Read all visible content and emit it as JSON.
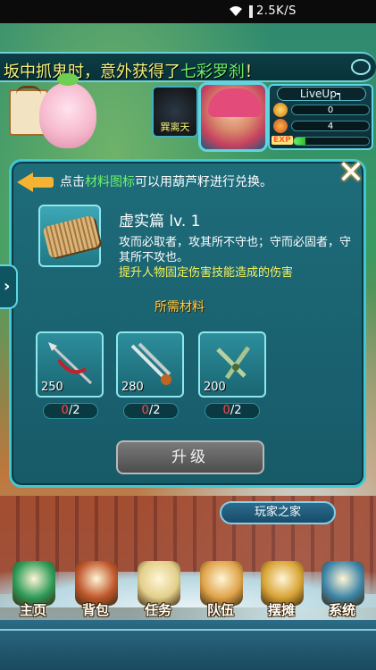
{
  "status_bar": {
    "network_speed": "2.5K/S"
  },
  "marquee": {
    "text_before": "坂中抓鬼时，意外获得了",
    "highlight": "七彩罗刹",
    "text_after": "！"
  },
  "player": {
    "pet_label": "巽离天",
    "name": "LiveUp┑",
    "gold": "0",
    "gems": "4",
    "exp_label": "EXP",
    "exp_progress": 0.15
  },
  "dialog": {
    "hint_before": "点击",
    "hint_highlight": "材料图标",
    "hint_after": "可以用葫芦籽进行兑换。",
    "item": {
      "title": "虚实篇 lv. 1",
      "description": "攻而必取者，攻其所不守也；守而必固者，守其所不攻也。",
      "effect": "提升人物固定伤害技能造成的伤害"
    },
    "required_label": "所需材料",
    "materials": [
      {
        "qty": "250",
        "have": "0",
        "need": "/2",
        "icon": "red-spear-icon"
      },
      {
        "qty": "280",
        "have": "0",
        "need": "/2",
        "icon": "twin-swords-icon"
      },
      {
        "qty": "200",
        "have": "0",
        "need": "/2",
        "icon": "twin-daggers-icon"
      }
    ],
    "upgrade_label": "升级"
  },
  "home_tag": "玩家之家",
  "nav": [
    {
      "label": "主页",
      "icon": "house-icon",
      "color": "#2e9b58"
    },
    {
      "label": "背包",
      "icon": "chest-icon",
      "color": "#c0572c"
    },
    {
      "label": "任务",
      "icon": "scroll-icon",
      "color": "#e3cf8b"
    },
    {
      "label": "队伍",
      "icon": "team-icon",
      "color": "#e0a34a"
    },
    {
      "label": "摆摊",
      "icon": "coin-stall-icon",
      "color": "#d8a335"
    },
    {
      "label": "系统",
      "icon": "gear-icon",
      "color": "#3f86a8"
    }
  ],
  "colors": {
    "accent": "#3fc7d6",
    "highlight_green": "#6ff36a",
    "effect_yellow": "#f6f25a",
    "missing_red": "#ff4a4a"
  }
}
